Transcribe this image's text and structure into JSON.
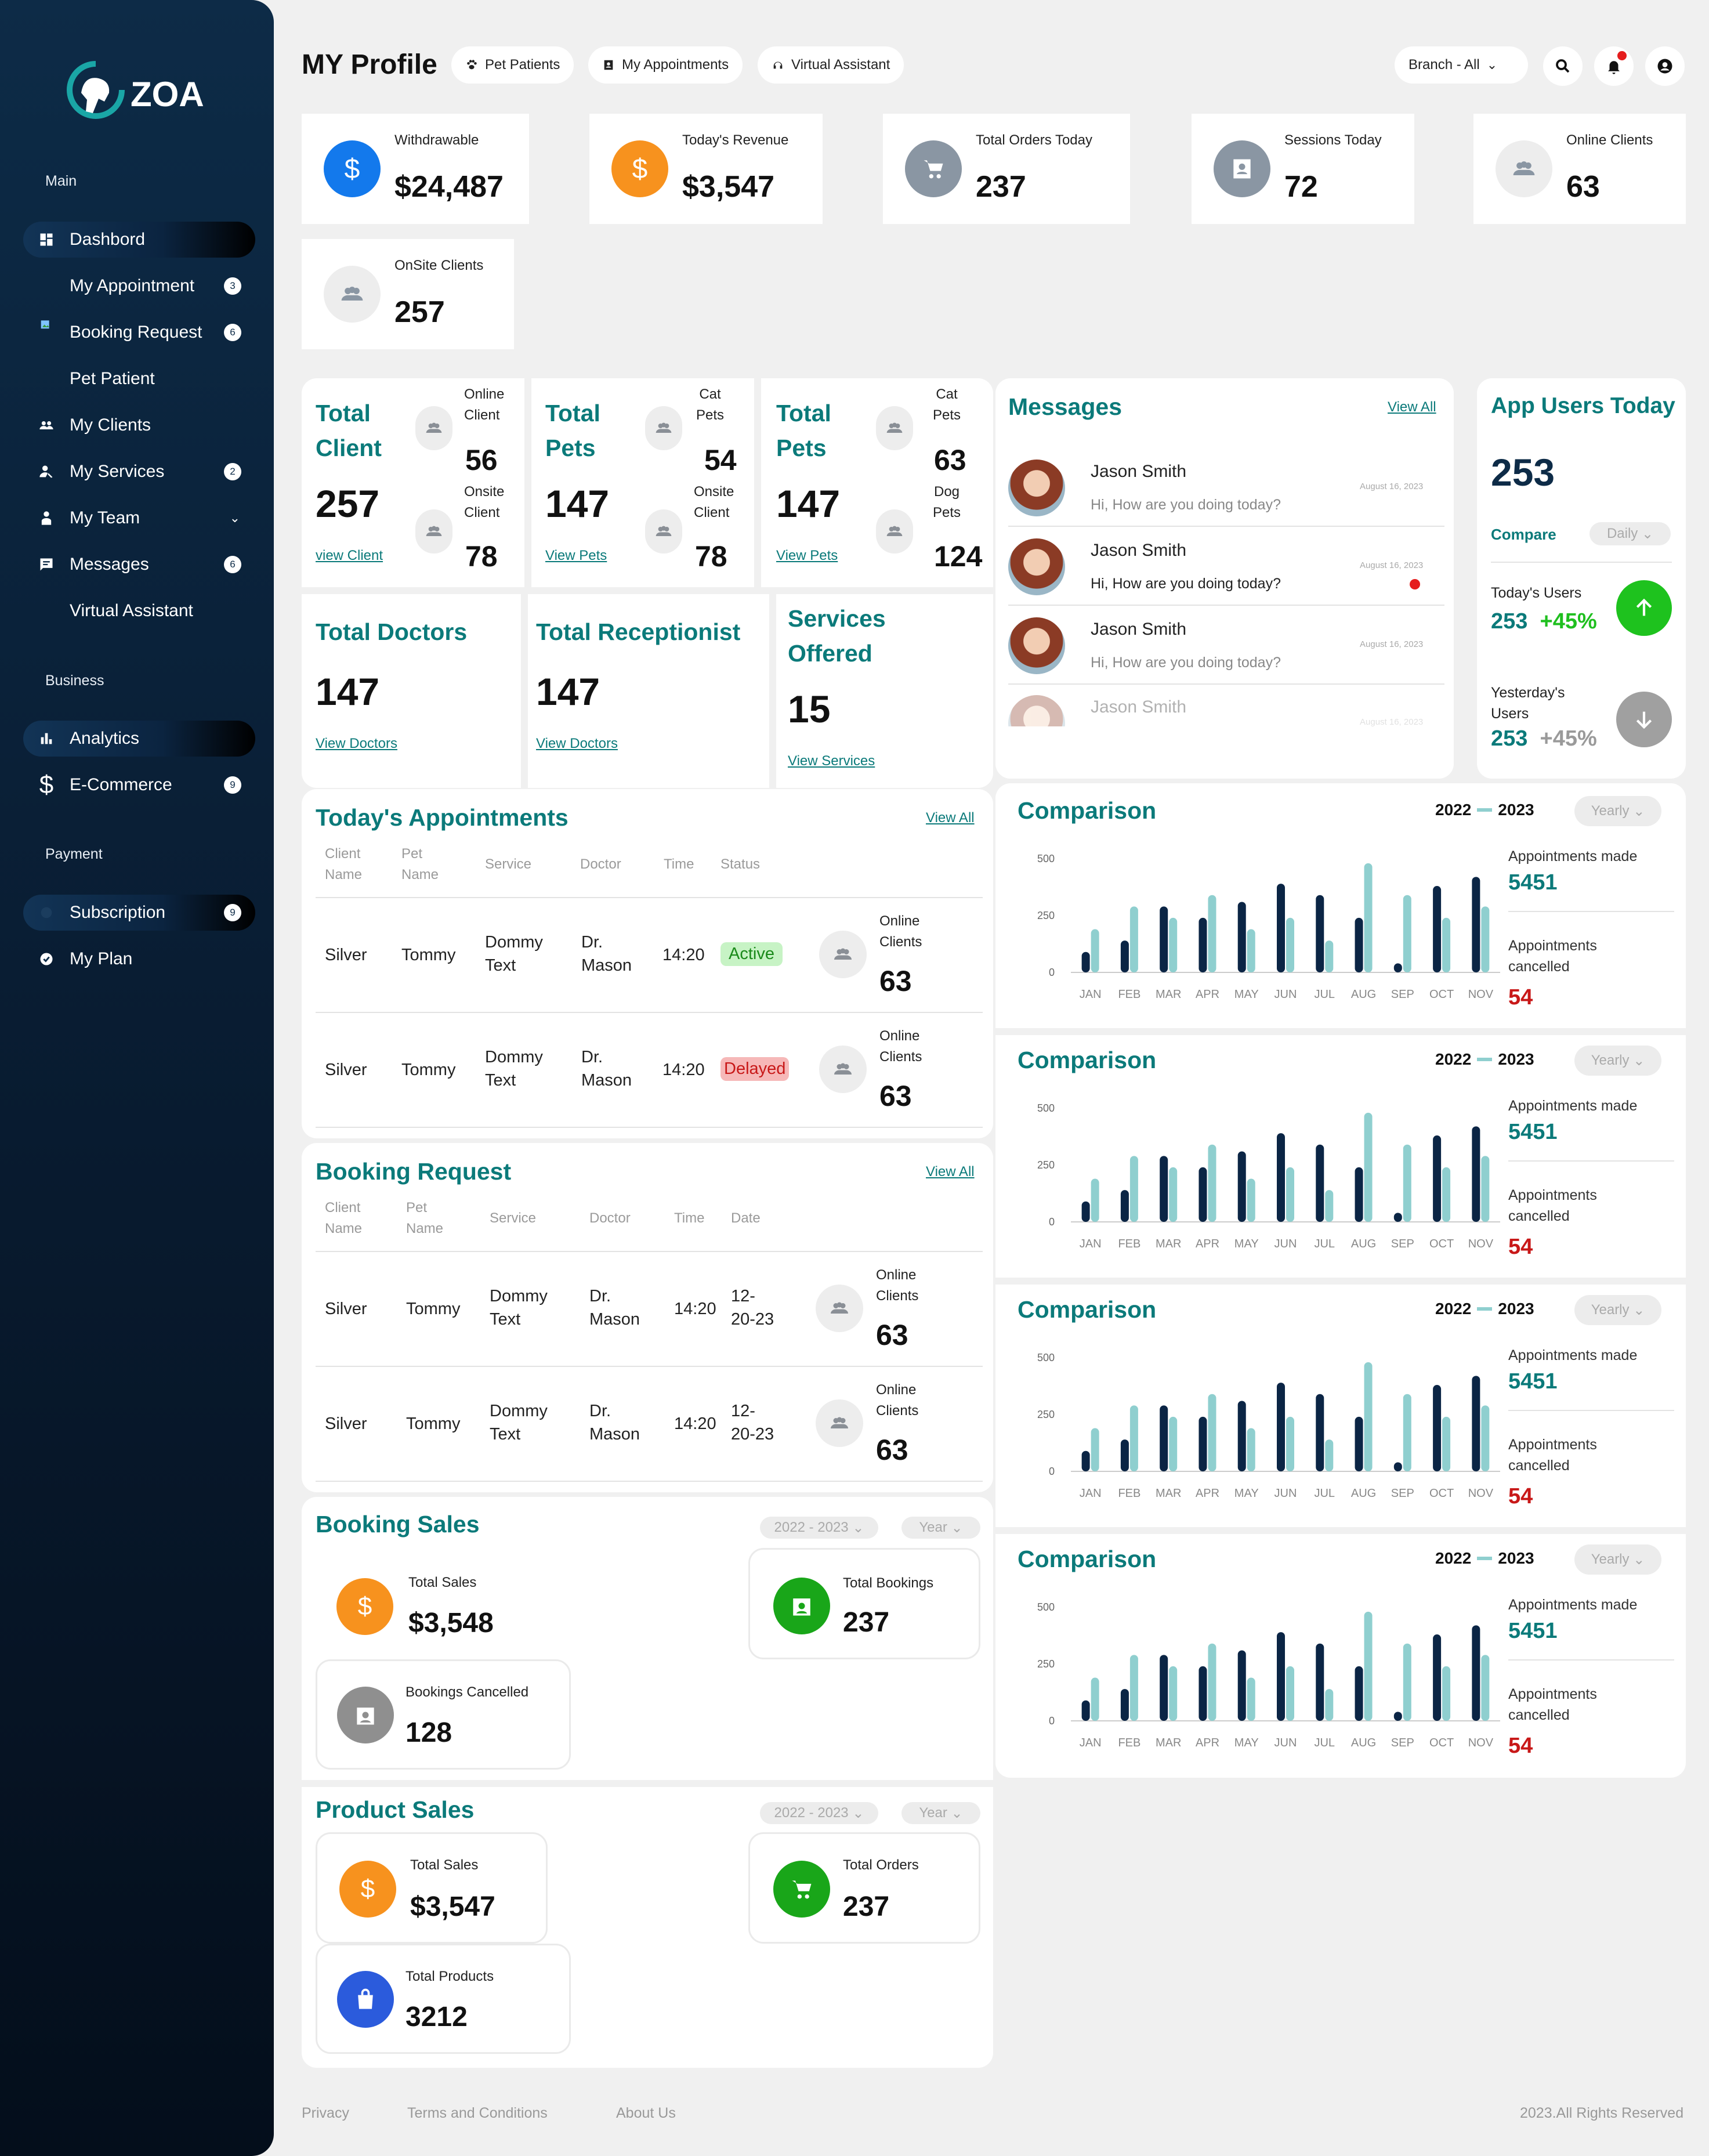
{
  "brand": {
    "name": "ZOA"
  },
  "sidebar": {
    "sections": [
      "Main",
      "Business",
      "Payment"
    ],
    "items": [
      {
        "label": "Dashbord",
        "icon": "dashboard-icon",
        "active": true
      },
      {
        "label": "My Appointment",
        "badge": "3"
      },
      {
        "label": "Booking Request",
        "icon": "booking-icon",
        "badge": "6"
      },
      {
        "label": "Pet Patient"
      },
      {
        "label": "My Clients",
        "icon": "clients-icon"
      },
      {
        "label": "My Services",
        "icon": "services-icon",
        "badge": "2"
      },
      {
        "label": "My Team",
        "icon": "team-icon"
      },
      {
        "label": "Messages",
        "icon": "messages-icon",
        "badge": "6"
      },
      {
        "label": "Virtual Assistant"
      },
      {
        "label": "Analytics",
        "icon": "analytics-icon",
        "active": true
      },
      {
        "label": "E-Commerce",
        "icon": "dollar-icon",
        "badge": "9"
      },
      {
        "label": "Subscription",
        "icon": "subscription-icon",
        "badge": "9",
        "active": true
      },
      {
        "label": "My Plan",
        "icon": "plan-icon"
      }
    ]
  },
  "header": {
    "title": "MY Profile",
    "pills": [
      "Pet Patients",
      "My Appointments",
      "Virtual Assistant"
    ],
    "branch": "Branch - All"
  },
  "stats": [
    {
      "label": "Withdrawable",
      "value": "$24,487",
      "color": "#1379ec",
      "icon": "dollar-icon"
    },
    {
      "label": "Today's Revenue",
      "value": "$3,547",
      "color": "#f7921e",
      "icon": "dollar-icon"
    },
    {
      "label": "Total Orders Today",
      "value": "237",
      "color": "#8a96a3",
      "icon": "cart-icon"
    },
    {
      "label": "Sessions Today",
      "value": "72",
      "color": "#8a96a3",
      "icon": "badge-icon"
    },
    {
      "label": "Online Clients",
      "value": "63",
      "color": "#ededed",
      "icon": "group-icon"
    },
    {
      "label": "OnSite Clients",
      "value": "257",
      "color": "#ededed",
      "icon": "group-icon"
    }
  ],
  "totals": [
    {
      "title1": "Total",
      "title2": "Client",
      "value": "257",
      "link": "view Client",
      "sub1": [
        "Online",
        "Client"
      ],
      "sub1v": "56",
      "sub2": [
        "Onsite",
        "Client"
      ],
      "sub2v": "78"
    },
    {
      "title1": "Total",
      "title2": "Pets",
      "value": "147",
      "link": "View Pets",
      "sub1": [
        "Cat",
        "Pets"
      ],
      "sub1v": "54",
      "sub2": [
        "Onsite",
        "Client"
      ],
      "sub2v": "78"
    },
    {
      "title1": "Total",
      "title2": "Pets",
      "value": "147",
      "link": "View Pets",
      "sub1": [
        "Cat",
        "Pets"
      ],
      "sub1v": "63",
      "sub2": [
        "Dog",
        "Pets"
      ],
      "sub2v": "124"
    }
  ],
  "totals2": [
    {
      "title": "Total Doctors",
      "value": "147",
      "link": "View Doctors"
    },
    {
      "title": "Total Receptionist",
      "value": "147",
      "link": "View Doctors"
    },
    {
      "title1": "Services",
      "title2": "Offered",
      "value": "15",
      "link": "View Services"
    }
  ],
  "messages": {
    "title": "Messages",
    "view_all": "View All",
    "items": [
      {
        "name": "Jason Smith",
        "text": "Hi, How are you doing today?",
        "date": "August 16, 2023"
      },
      {
        "name": "Jason Smith",
        "text": "Hi, How are you doing today?",
        "date": "August 16, 2023"
      },
      {
        "name": "Jason Smith",
        "text": "Hi, How are you doing today?",
        "date": "August 16, 2023"
      },
      {
        "name": "Jason Smith",
        "text": "",
        "date": "August 16, 2023"
      }
    ]
  },
  "app_users": {
    "title": "App Users Today",
    "value": "253",
    "compare": "Compare",
    "period": "Daily",
    "today_label": "Today's Users",
    "today_value": "253",
    "today_change": "+45%",
    "yesterday_label1": "Yesterday's",
    "yesterday_label2": "Users",
    "yesterday_value": "253",
    "yesterday_change": "+45%"
  },
  "appointments": {
    "title": "Today's Appointments",
    "view_all": "View All",
    "headers": [
      [
        "Client",
        "Name"
      ],
      [
        "Pet",
        "Name"
      ],
      [
        "Service"
      ],
      [
        "Doctor"
      ],
      [
        "Time"
      ],
      [
        "Status"
      ]
    ],
    "rows": [
      {
        "client": "Silver",
        "pet": "Tommy",
        "service1": "Dommy",
        "service2": "Text",
        "doctor1": "Dr.",
        "doctor2": "Mason",
        "time": "14:20",
        "status": "Active",
        "side1": "Online",
        "side2": "Clients",
        "sidev": "63"
      },
      {
        "client": "Silver",
        "pet": "Tommy",
        "service1": "Dommy",
        "service2": "Text",
        "doctor1": "Dr.",
        "doctor2": "Mason",
        "time": "14:20",
        "status": "Delayed",
        "side1": "Online",
        "side2": "Clients",
        "sidev": "63"
      }
    ]
  },
  "booking": {
    "title": "Booking Request",
    "view_all": "View All",
    "headers": [
      [
        "Client",
        "Name"
      ],
      [
        "Pet",
        "Name"
      ],
      [
        "Service"
      ],
      [
        "Doctor"
      ],
      [
        "Time"
      ],
      [
        "Date"
      ]
    ],
    "rows": [
      {
        "client": "Silver",
        "pet": "Tommy",
        "service1": "Dommy",
        "service2": "Text",
        "doctor1": "Dr.",
        "doctor2": "Mason",
        "time": "14:20",
        "date1": "12-",
        "date2": "20-23",
        "side1": "Online",
        "side2": "Clients",
        "sidev": "63"
      },
      {
        "client": "Silver",
        "pet": "Tommy",
        "service1": "Dommy",
        "service2": "Text",
        "doctor1": "Dr.",
        "doctor2": "Mason",
        "time": "14:20",
        "date1": "12-",
        "date2": "20-23",
        "side1": "Online",
        "side2": "Clients",
        "sidev": "63"
      }
    ]
  },
  "booking_sales": {
    "title": "Booking Sales",
    "range": "2022 - 2023",
    "period": "Year",
    "cards": [
      {
        "label": "Total Sales",
        "value": "$3,548",
        "color": "#f7921e",
        "icon": "dollar-icon"
      },
      {
        "label": "Total Bookings",
        "value": "237",
        "color": "#19a619",
        "icon": "calendar-icon"
      },
      {
        "label": "Bookings Cancelled",
        "value": "128",
        "color": "#8f8f8f",
        "icon": "calendar-icon"
      }
    ]
  },
  "product_sales": {
    "title": "Product Sales",
    "range": "2022 - 2023",
    "period": "Year",
    "cards": [
      {
        "label": "Total Sales",
        "value": "$3,547",
        "color": "#f7921e",
        "icon": "dollar-icon"
      },
      {
        "label": "Total Orders",
        "value": "237",
        "color": "#19a619",
        "icon": "cart-icon"
      },
      {
        "label": "Total Products",
        "value": "3212",
        "color": "#2b5bdc",
        "icon": "bag-icon"
      }
    ]
  },
  "comparison": {
    "title": "Comparison",
    "year_a": "2022",
    "year_b": "2023",
    "period": "Yearly",
    "made_label": "Appointments made",
    "made_value": "5451",
    "cancel_label1": "Appointments",
    "cancel_label2": "cancelled",
    "cancel_value": "54"
  },
  "chart_data": {
    "type": "bar",
    "categories": [
      "JAN",
      "FEB",
      "MAR",
      "APR",
      "MAY",
      "JUN",
      "JUL",
      "AUG",
      "SEP",
      "OCT",
      "NOV"
    ],
    "series": [
      {
        "name": "2022",
        "color": "#0b2545",
        "values": [
          90,
          140,
          290,
          240,
          310,
          390,
          340,
          240,
          40,
          380,
          420
        ]
      },
      {
        "name": "2023",
        "color": "#8fcfcf",
        "values": [
          190,
          290,
          240,
          340,
          190,
          240,
          140,
          480,
          340,
          240,
          290
        ]
      }
    ],
    "ylim": [
      0,
      500
    ],
    "yticks": [
      0,
      250,
      500
    ]
  },
  "footer": {
    "links": [
      "Privacy",
      "Terms and Conditions",
      "About Us"
    ],
    "copyright": "2023.All Rights Reserved"
  }
}
